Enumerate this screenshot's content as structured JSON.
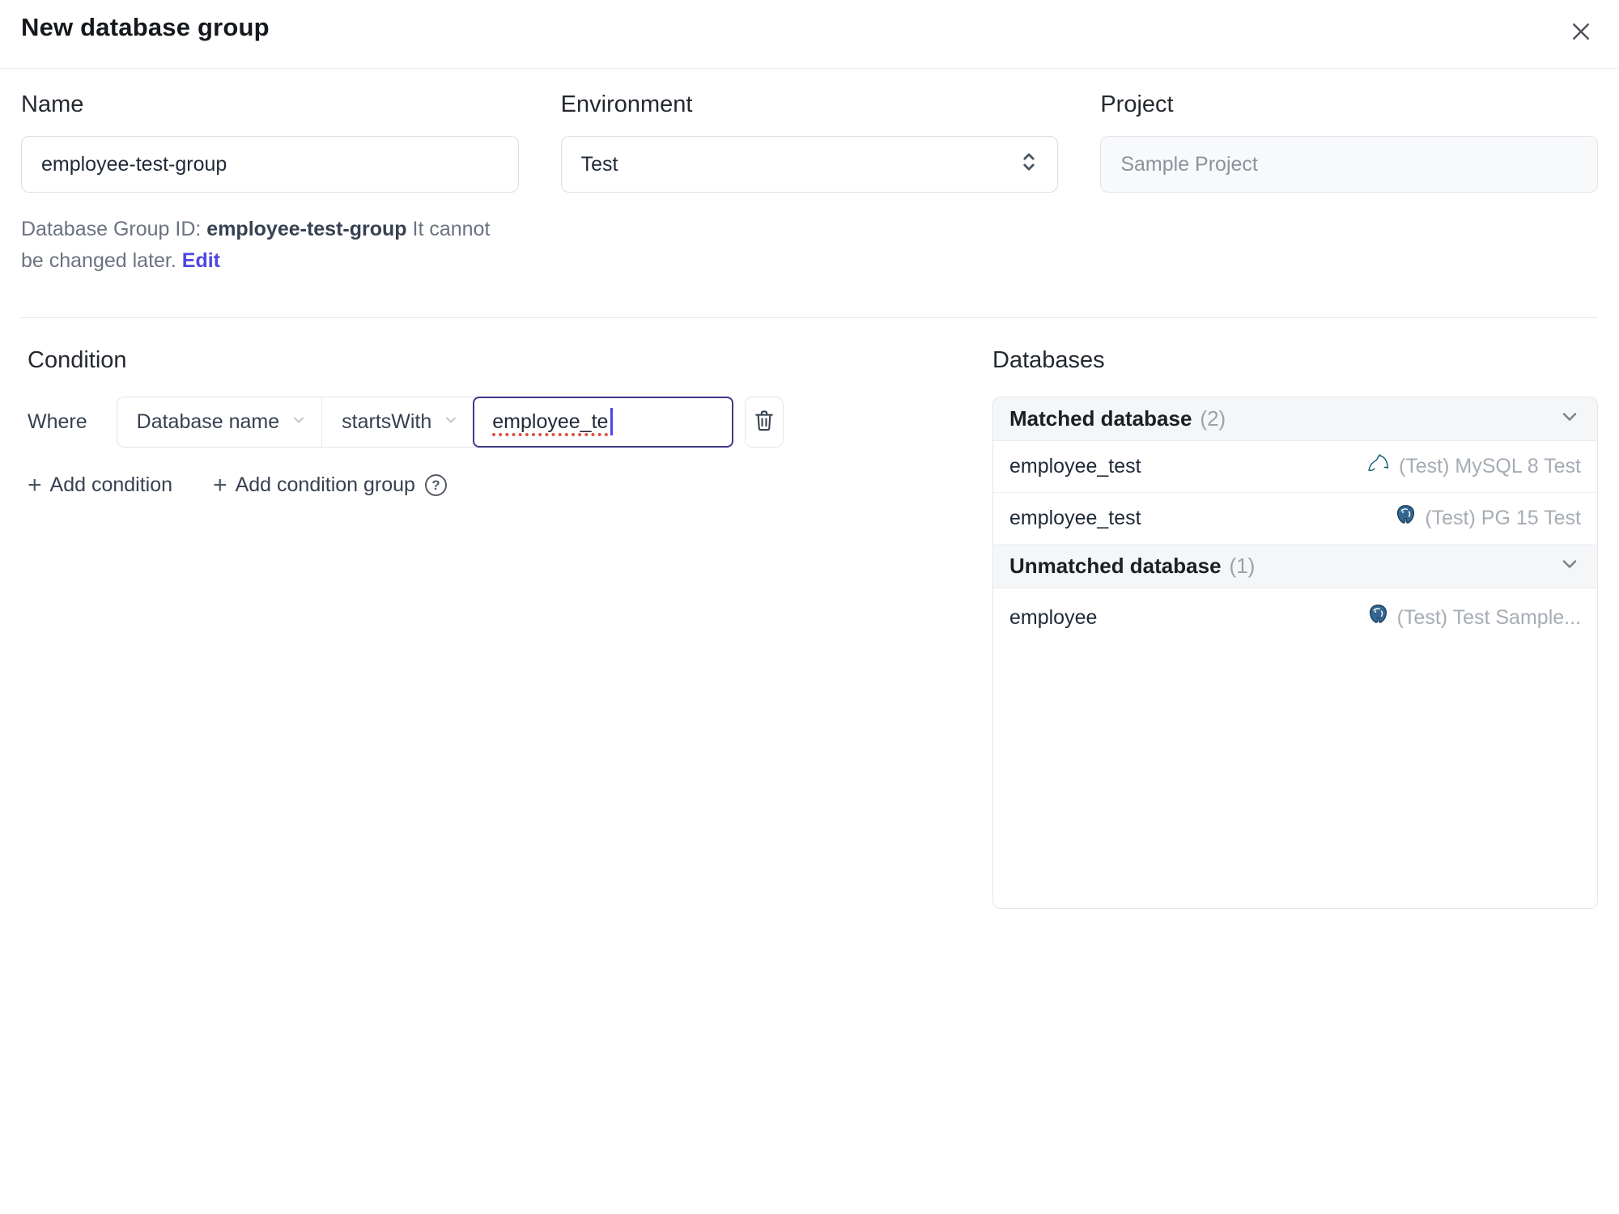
{
  "dialog": {
    "title": "New database group"
  },
  "form": {
    "name": {
      "label": "Name",
      "value": "employee-test-group"
    },
    "environment": {
      "label": "Environment",
      "value": "Test"
    },
    "project": {
      "label": "Project",
      "value": "Sample Project"
    },
    "id_hint": {
      "prefix": "Database Group ID: ",
      "id": "employee-test-group",
      "suffix": " It cannot be changed later. ",
      "edit_label": "Edit"
    }
  },
  "condition": {
    "heading": "Condition",
    "where_label": "Where",
    "factor": "Database name",
    "operator": "startsWith",
    "value": "employee_te",
    "add_condition_label": "Add condition",
    "add_condition_group_label": "Add condition group"
  },
  "databases": {
    "heading": "Databases",
    "sections": [
      {
        "title": "Matched database",
        "count": "(2)",
        "rows": [
          {
            "name": "employee_test",
            "engine": "mysql",
            "instance": "(Test) MySQL 8 Test"
          },
          {
            "name": "employee_test",
            "engine": "postgresql",
            "instance": "(Test) PG 15 Test"
          }
        ]
      },
      {
        "title": "Unmatched database",
        "count": "(1)",
        "rows": [
          {
            "name": "employee",
            "engine": "postgresql",
            "instance": "(Test) Test Sample..."
          }
        ]
      }
    ]
  },
  "glyphs": {
    "plus": "+",
    "help": "?"
  },
  "colors": {
    "accent": "#4f46e5",
    "focus_border": "#3e3888",
    "spellcheck_underline": "#dd5144",
    "section_header_bg": "#f5f6f8",
    "muted_text": "#a6acb5",
    "mysql_icon": "#10596f",
    "postgresql_icon": "#336791"
  }
}
